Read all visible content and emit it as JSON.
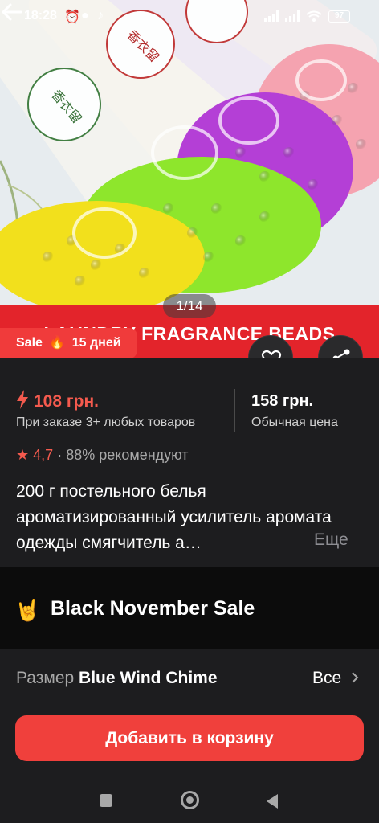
{
  "status_bar": {
    "time": "18:28",
    "battery": "97"
  },
  "gallery": {
    "counter": "1/14",
    "banner_text": "LAUNDRY FRAGRANCE BEADS"
  },
  "sale_badge": {
    "label": "Sale",
    "icon": "fire-icon",
    "days": "15 дней"
  },
  "price": {
    "discounted": "108 грн.",
    "discount_condition": "При заказе 3+ любых товаров",
    "regular": "158 грн.",
    "regular_label": "Обычная цена"
  },
  "rating": {
    "value": "4,7",
    "recommend": "88% рекомендуют"
  },
  "product": {
    "title": "200 г постельного белья ароматизированный усилитель аромата одежды смягчитель а…",
    "more_label": "Еще"
  },
  "promo": {
    "icon": "rock-hand-icon",
    "label": "Black November Sale"
  },
  "size": {
    "label": "Размер",
    "value": "Blue Wind Chime",
    "all_label": "Все"
  },
  "actions": {
    "add_to_cart": "Добавить в корзину"
  },
  "colors": {
    "accent": "#f0403c",
    "background": "#1d1d1f",
    "promo_bg": "#0c0c0c"
  }
}
